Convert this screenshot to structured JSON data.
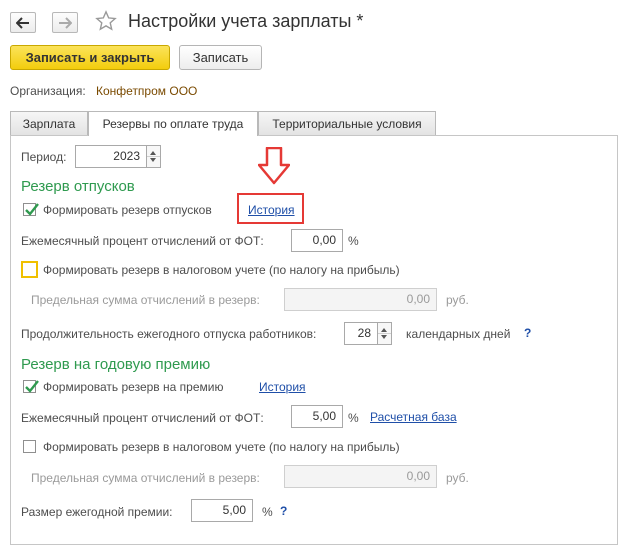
{
  "window": {
    "title": "Настройки учета зарплаты *",
    "star": "☆"
  },
  "toolbar": {
    "save_close_label": "Записать и закрыть",
    "save_label": "Записать"
  },
  "organization": {
    "label": "Организация:",
    "value": "Конфетпром ООО"
  },
  "tabs": [
    {
      "label": "Зарплата",
      "active": false
    },
    {
      "label": "Резервы по оплате труда",
      "active": true
    },
    {
      "label": "Территориальные условия",
      "active": false
    }
  ],
  "period": {
    "label": "Период:",
    "value": "2023"
  },
  "vacation": {
    "section_title": "Резерв отпусков",
    "form_reserve_label": "Формировать резерв отпусков",
    "form_reserve_checked": true,
    "history_link": "История",
    "monthly_percent_label": "Ежемесячный процент отчислений от ФОТ:",
    "monthly_percent_value": "0,00",
    "percent_sign": "%",
    "tax_reserve_label": "Формировать резерв в налоговом учете (по налогу на прибыль)",
    "tax_reserve_checked": false,
    "limit_label": "Предельная сумма отчислений в резерв:",
    "limit_value": "0,00",
    "limit_unit": "руб.",
    "duration_label": "Продолжительность ежегодного отпуска работников:",
    "duration_value": "28",
    "duration_unit": "календарных дней",
    "help": "?"
  },
  "bonus": {
    "section_title": "Резерв на годовую премию",
    "form_reserve_label": "Формировать резерв на премию",
    "form_reserve_checked": true,
    "history_link": "История",
    "monthly_percent_label": "Ежемесячный процент отчислений от ФОТ:",
    "monthly_percent_value": "5,00",
    "percent_sign": "%",
    "base_link": "Расчетная база",
    "tax_reserve_label": "Формировать резерв в налоговом учете (по налогу на прибыль)",
    "tax_reserve_checked": false,
    "limit_label": "Предельная сумма отчислений в резерв:",
    "limit_value": "0,00",
    "limit_unit": "руб.",
    "annual_size_label": "Размер ежегодной премии:",
    "annual_size_value": "5,00",
    "annual_size_unit": "%",
    "help": "?"
  },
  "colors": {
    "accent_green": "#2f9a4f",
    "link_blue": "#1f4fa8",
    "primary_yellow": "#f3cd0d",
    "highlight_red": "#e53935"
  }
}
